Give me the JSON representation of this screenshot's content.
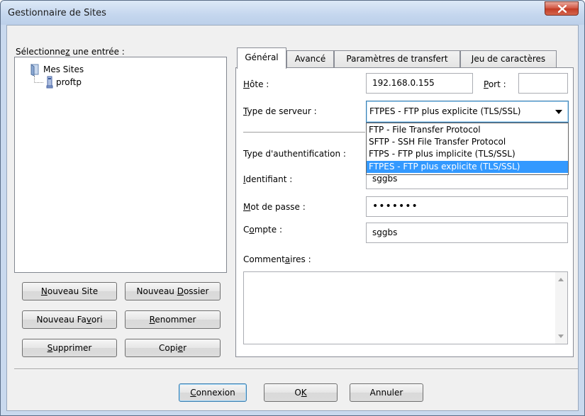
{
  "window": {
    "title": "Gestionnaire de Sites"
  },
  "left": {
    "select_label_pre": "Sélectionne",
    "select_label_u": "z",
    "select_label_post": " une entrée :",
    "tree": {
      "root_label": "Mes Sites",
      "child_label": "proftp"
    },
    "buttons": {
      "new_site_pre": "",
      "new_site_u": "N",
      "new_site_post": "ouveau Site",
      "new_folder_pre": "Nouveau ",
      "new_folder_u": "D",
      "new_folder_post": "ossier",
      "new_bookmark_pre": "Nouveau Fa",
      "new_bookmark_u": "v",
      "new_bookmark_post": "ori",
      "rename_pre": "",
      "rename_u": "R",
      "rename_post": "enommer",
      "delete_pre": "",
      "delete_u": "S",
      "delete_post": "upprimer",
      "copy_pre": "Copi",
      "copy_u": "e",
      "copy_post": "r"
    }
  },
  "tabs": [
    {
      "label": "Général"
    },
    {
      "label": "Avancé"
    },
    {
      "label": "Paramètres de transfert"
    },
    {
      "label": "Jeu de caractères"
    }
  ],
  "general": {
    "host_label_u": "H",
    "host_label_post": "ôte :",
    "host_value": "192.168.0.155",
    "port_label_u": "P",
    "port_label_post": "ort :",
    "port_value": "",
    "server_type_label_u": "T",
    "server_type_label_post": "ype de serveur :",
    "server_type_value": "FTPES - FTP plus explicite (TLS/SSL)",
    "server_type_options": [
      "FTP - File Transfer Protocol",
      "SFTP - SSH File Transfer Protocol",
      "FTPS - FTP plus implicite (TLS/SSL)",
      "FTPES - FTP plus explicite (TLS/SSL)"
    ],
    "auth_type_label": "Type d'authentification :",
    "user_label_u": "I",
    "user_label_post": "dentifiant :",
    "user_value": "sggbs",
    "password_label_u": "M",
    "password_label_post": "ot de passe :",
    "password_value": "•••••••",
    "account_label_pre": "C",
    "account_label_u": "o",
    "account_label_post": "mpte :",
    "account_value": "sggbs",
    "comments_label_pre": "Comment",
    "comments_label_u": "a",
    "comments_label_post": "ires :"
  },
  "footer": {
    "connect_u": "C",
    "connect_post": "onnexion",
    "ok_pre": "O",
    "ok_u": "K",
    "cancel": "Annuler"
  }
}
